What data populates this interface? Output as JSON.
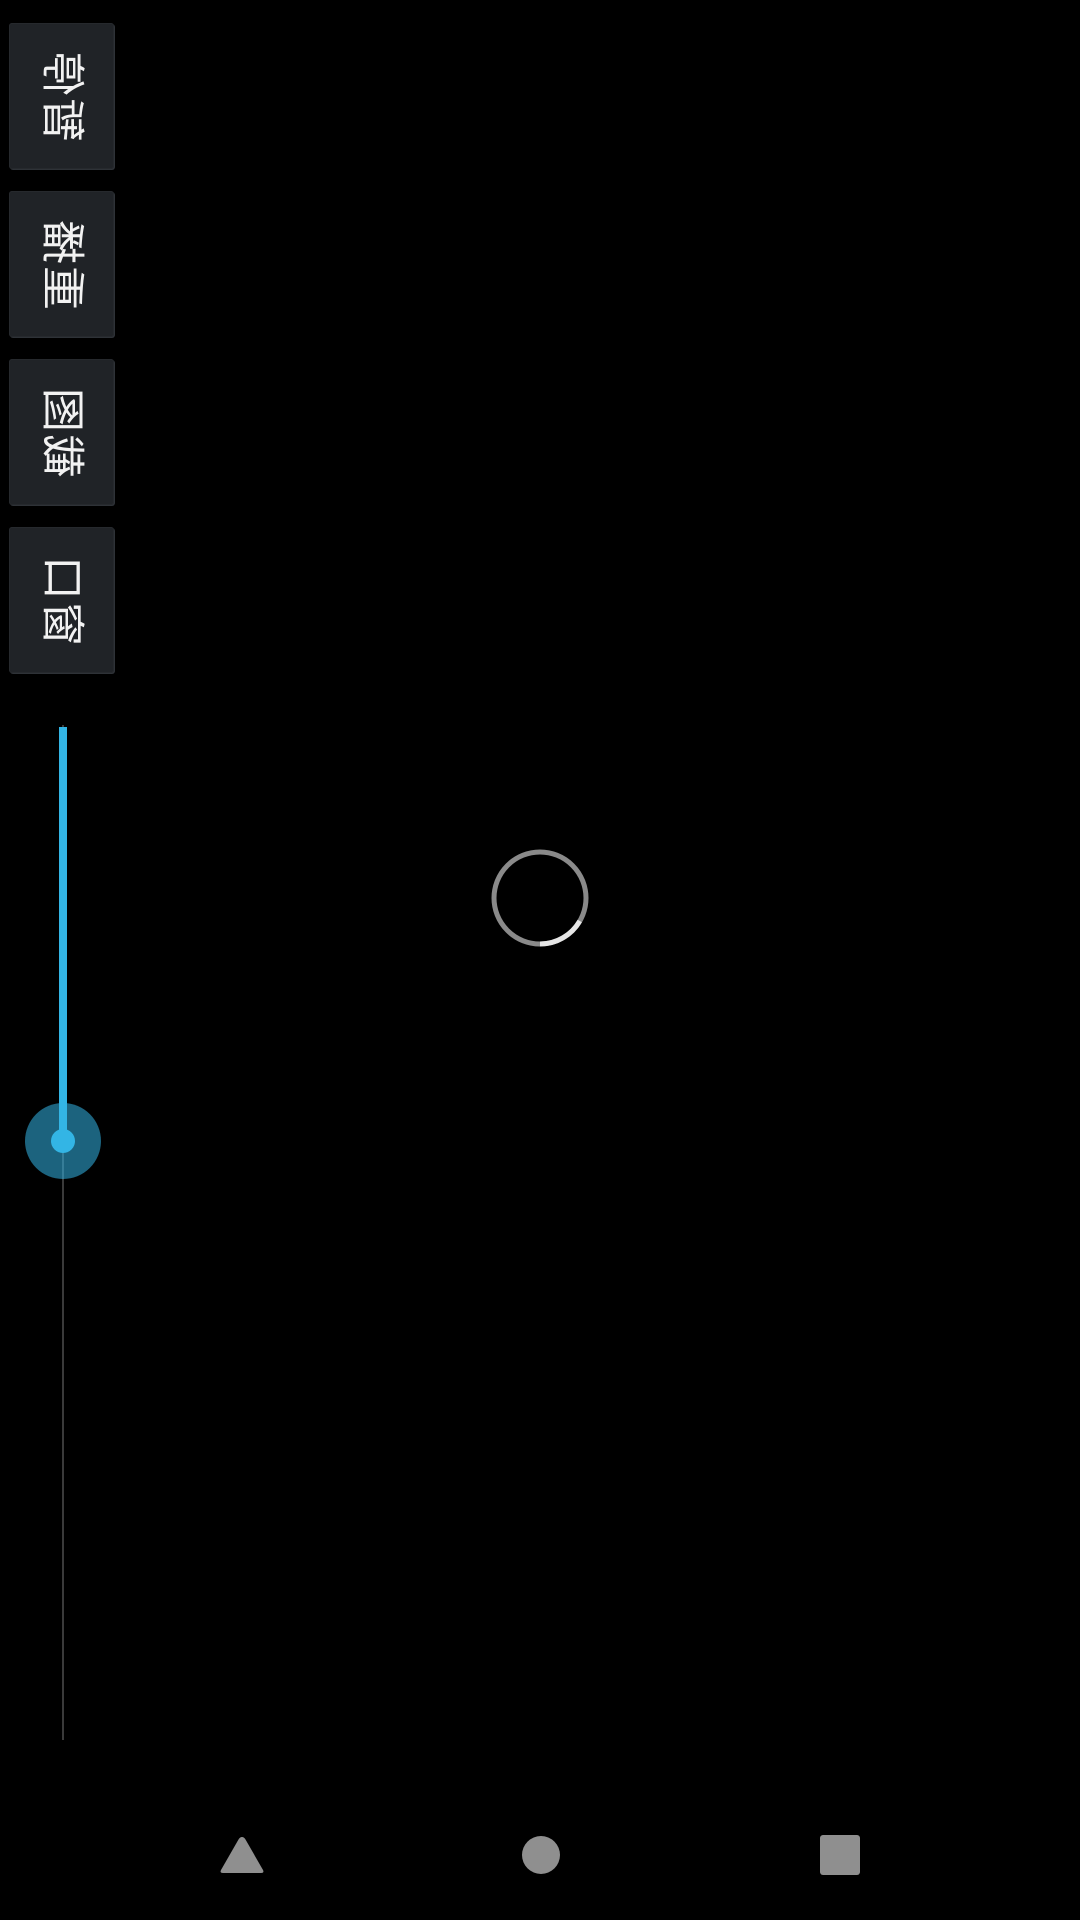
{
  "controls": {
    "pause_label": "暂停",
    "replay_label": "重播",
    "screenshot_label": "截图",
    "window_label": "窗口"
  },
  "slider": {
    "value_fraction": 0.41,
    "fill_color": "#33b5e5",
    "track_color": "#3a3a3a"
  },
  "loading": {
    "icon": "loading-spinner-icon",
    "ring_color": "#8a8a8a",
    "arc_color": "#e6e6e6"
  },
  "navigation": {
    "back_icon": "triangle-back-icon",
    "home_icon": "circle-home-icon",
    "recents_icon": "square-recents-icon",
    "icon_color": "#8f8f8f"
  }
}
